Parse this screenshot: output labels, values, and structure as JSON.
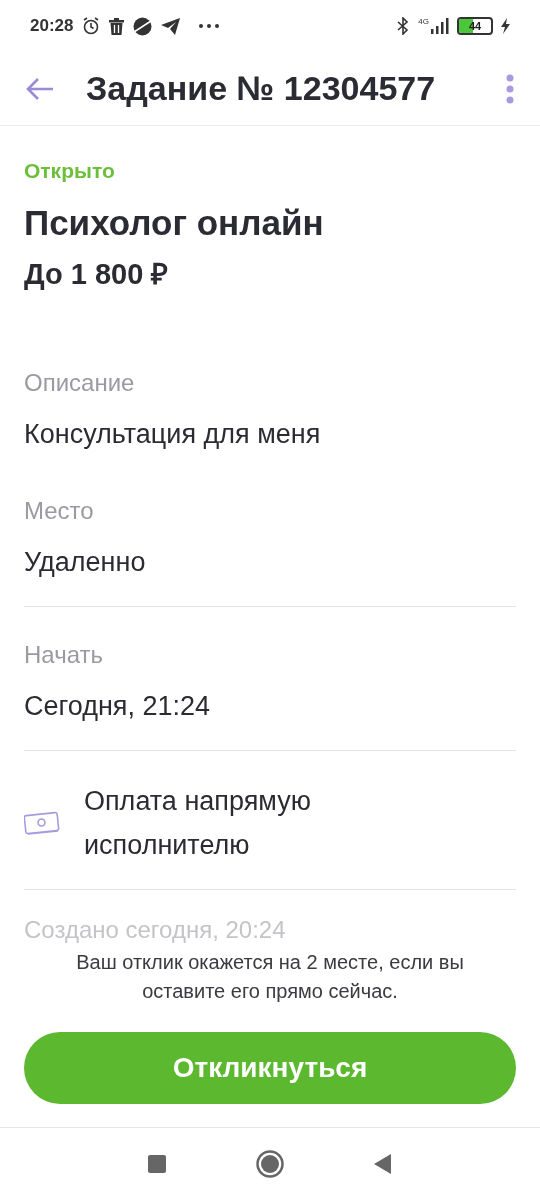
{
  "status_bar": {
    "time": "20:28",
    "network": "4G",
    "battery": "44"
  },
  "header": {
    "title": "Задание № 12304577"
  },
  "task": {
    "status": "Открыто",
    "title": "Психолог онлайн",
    "price": "До 1 800 ₽"
  },
  "fields": [
    {
      "kind": "field",
      "label": "Описание",
      "value": "Консультация для меня",
      "divider_after": false
    },
    {
      "kind": "field",
      "label": "Место",
      "value": "Удаленно",
      "divider_after": true
    },
    {
      "kind": "field",
      "label": "Начать",
      "value": "Сегодня, 21:24",
      "divider_after": true
    },
    {
      "kind": "payment",
      "value": "Оплата напрямую исполнителю",
      "divider_after": true
    },
    {
      "kind": "faded",
      "value": "Создано сегодня, 20:24",
      "divider_after": false
    }
  ],
  "footer": {
    "note": "Ваш отклик окажется на 2 месте, если вы оставите его прямо сейчас.",
    "button": "Откликнуться"
  }
}
